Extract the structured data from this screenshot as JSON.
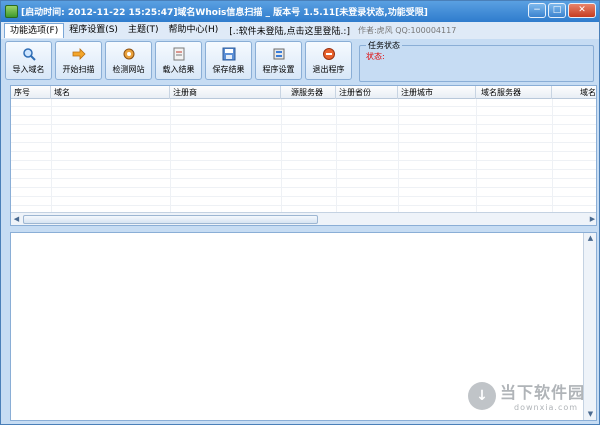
{
  "window": {
    "title": "[启动时间: 2012-11-22 15:25:47]域名Whois信息扫描 _ 版本号 1.5.11[未登录状态,功能受限]",
    "controls": {
      "minimize": "−",
      "maximize": "□",
      "close": "✕"
    }
  },
  "menu": {
    "items": [
      {
        "label": "功能选项(F)",
        "active": true
      },
      {
        "label": "程序设置(S)"
      },
      {
        "label": "主题(T)"
      },
      {
        "label": "帮助中心(H)"
      }
    ],
    "notice": "[.:软件未登陆,点击这里登陆.:]",
    "author": "作者:虎风 QQ:100004117"
  },
  "toolbar": {
    "buttons": [
      {
        "label": "导入域名",
        "icon": "magnifier-icon"
      },
      {
        "label": "开始扫描",
        "icon": "arrow-right-icon"
      },
      {
        "label": "检测网站",
        "icon": "gear-icon"
      },
      {
        "label": "载入结果",
        "icon": "document-icon"
      },
      {
        "label": "保存结果",
        "icon": "save-icon"
      },
      {
        "label": "程序设置",
        "icon": "settings-icon"
      },
      {
        "label": "退出程序",
        "icon": "stop-icon"
      }
    ]
  },
  "status": {
    "legend": "任务状态",
    "text": "状态:"
  },
  "table": {
    "columns": [
      "序号",
      "域名",
      "注册商",
      "源服务器",
      "注册省份",
      "注册城市",
      "域名服务器",
      "域名"
    ]
  },
  "watermark": {
    "main": "当下软件园",
    "sub": "downxia.com"
  },
  "colors": {
    "title_bar": "#2f7ccd",
    "status_red": "#e00000",
    "frame": "#c6dcf3"
  }
}
